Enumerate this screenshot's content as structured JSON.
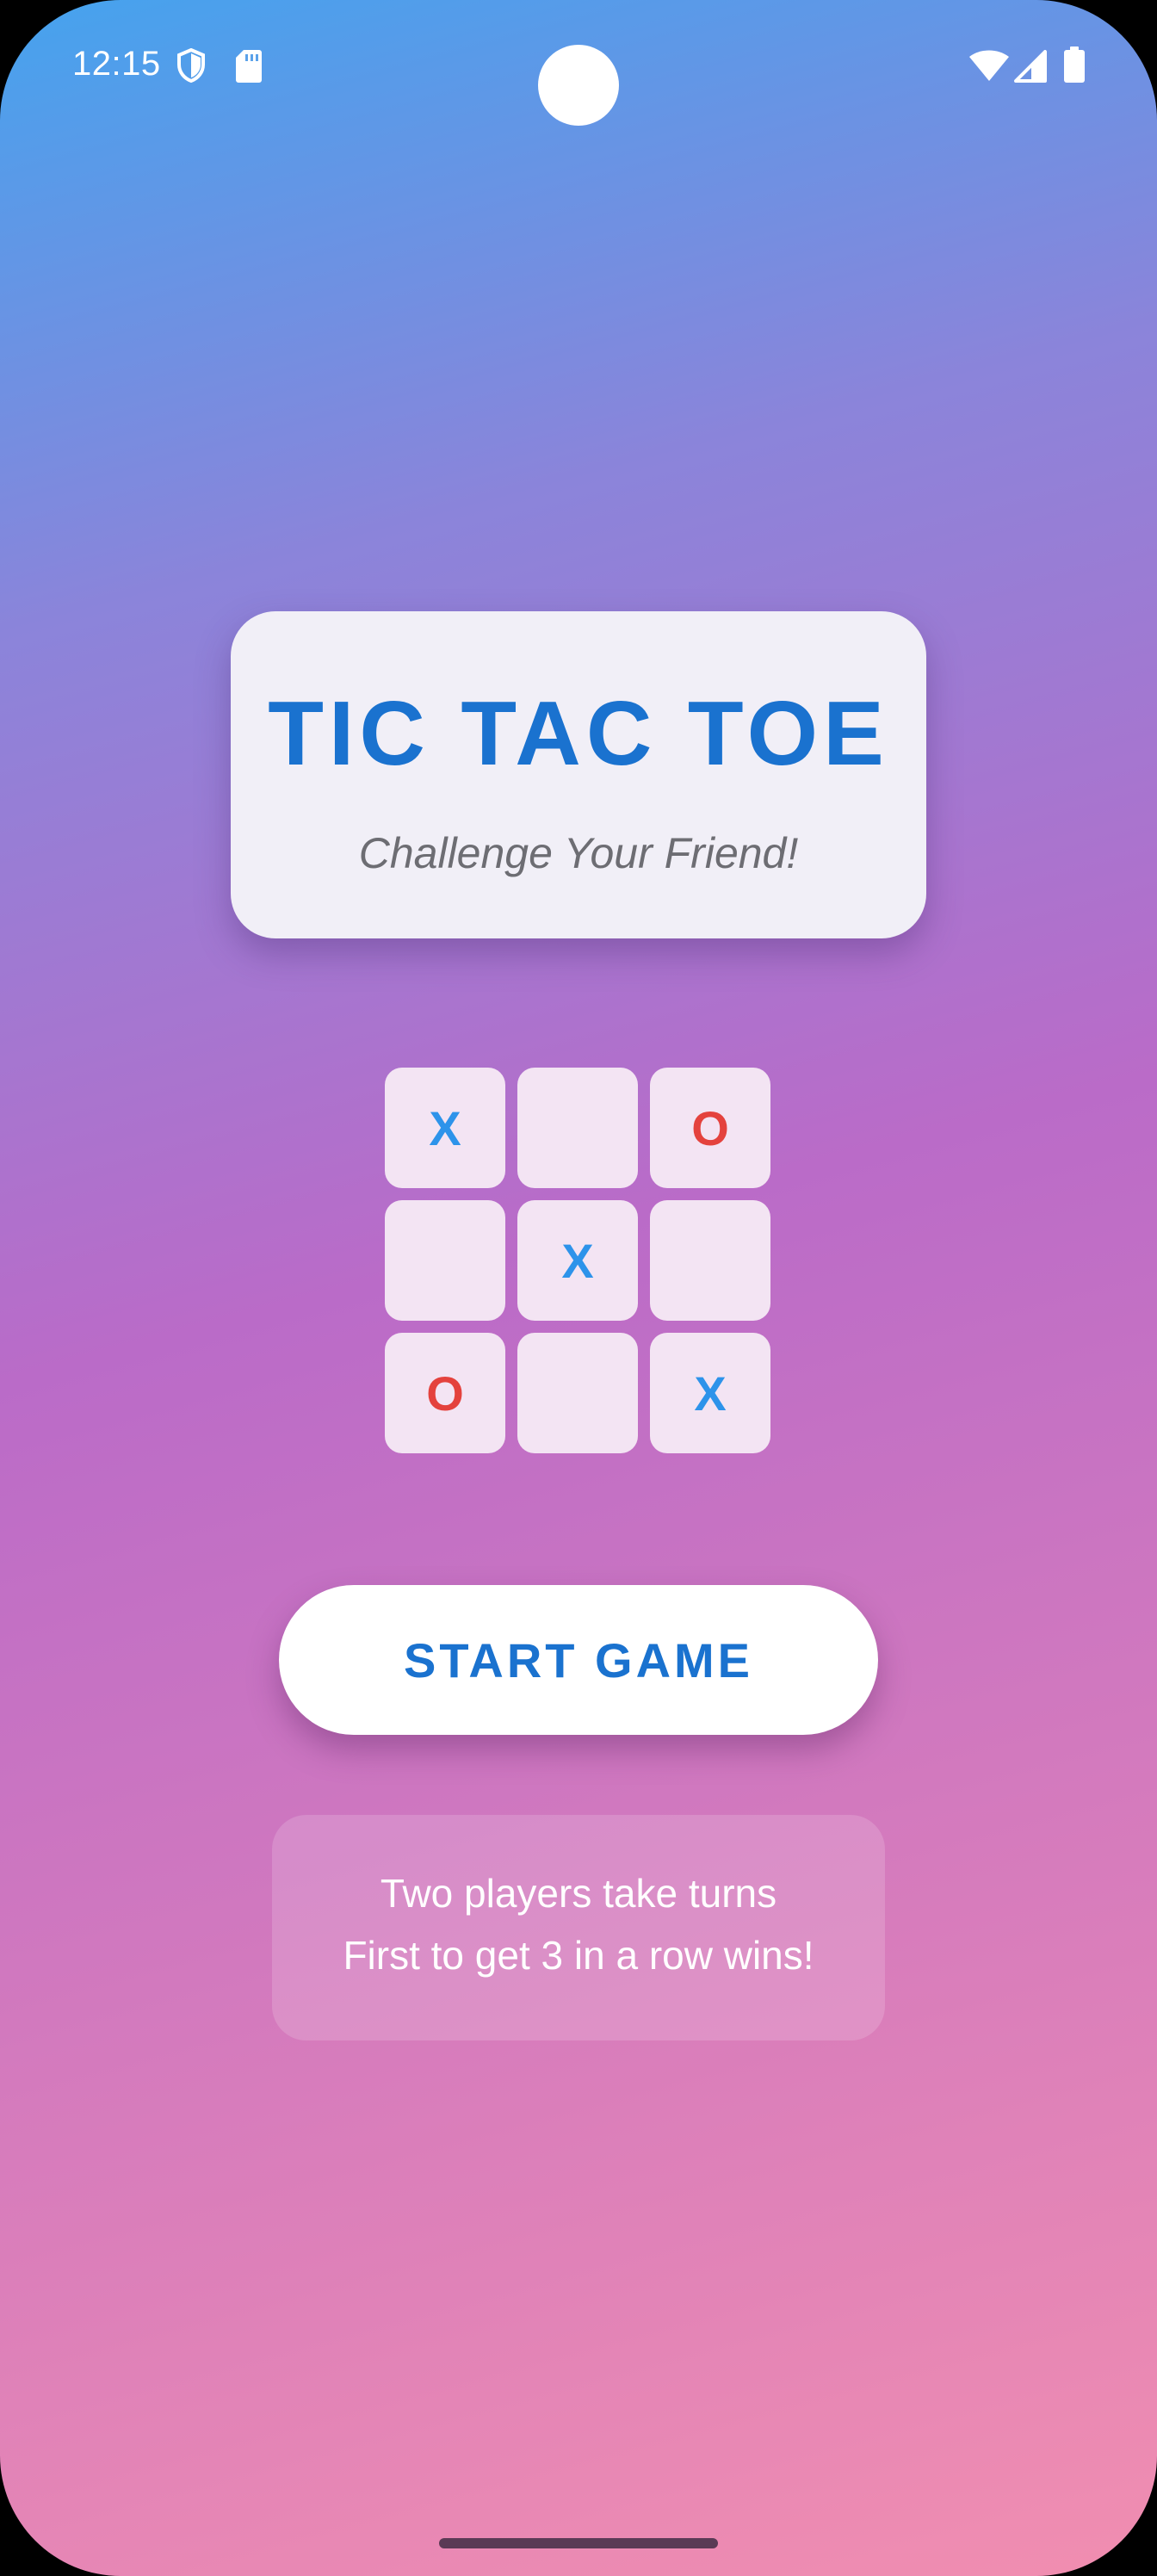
{
  "status_bar": {
    "time": "12:15",
    "left_icons": [
      "shield-icon",
      "sd-card-icon"
    ],
    "right_icons": [
      "wifi-icon",
      "cellular-signal-icon",
      "battery-icon"
    ]
  },
  "title_card": {
    "title": "TIC TAC TOE",
    "subtitle": "Challenge Your Friend!"
  },
  "board": {
    "cells": [
      "X",
      "",
      "O",
      "",
      "X",
      "",
      "O",
      "",
      "X"
    ]
  },
  "start_button": {
    "label": "START GAME"
  },
  "info": {
    "line1": "Two players take turns",
    "line2": "First to get 3 in a row wins!"
  },
  "colors": {
    "x_color": "#2d93ea",
    "o_color": "#e4423d",
    "accent": "#1a72cf",
    "gradient_top": "#45a3ee",
    "gradient_mid": "#ba6bc8",
    "gradient_bottom": "#f18eb0"
  }
}
